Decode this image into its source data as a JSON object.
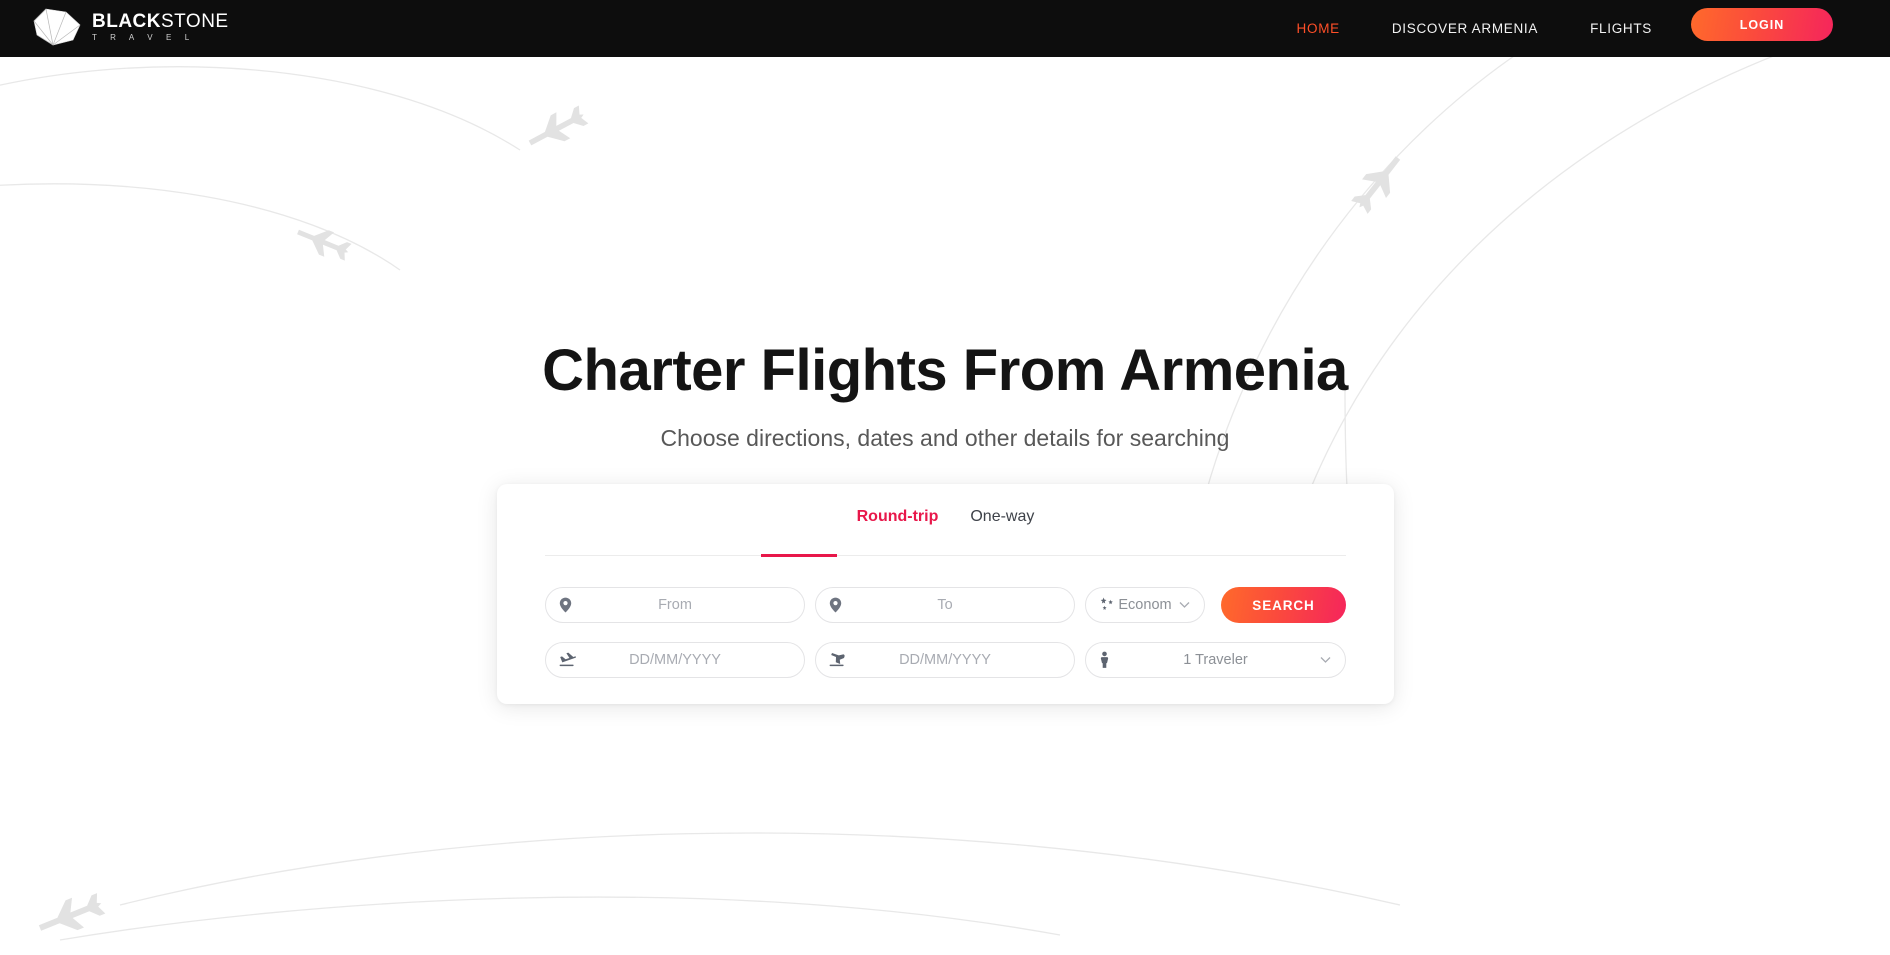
{
  "header": {
    "logo": {
      "word_bold": "BLACK",
      "word_light": "STONE",
      "subtitle": "T R A V E L",
      "mark_icon": "gem-stone-icon"
    },
    "nav": [
      {
        "label": "HOME",
        "active": true
      },
      {
        "label": "DISCOVER ARMENIA",
        "active": false
      },
      {
        "label": "FLIGHTS",
        "active": false
      }
    ],
    "login_label": "LOGIN",
    "background_color": "#0d0d0d",
    "accent_color": "#ff4f28"
  },
  "hero": {
    "title": "Charter Flights From Armenia",
    "subtitle": "Choose directions, dates and other details for searching"
  },
  "search": {
    "tabs": [
      {
        "label": "Round-trip",
        "active": true
      },
      {
        "label": "One-way",
        "active": false
      }
    ],
    "active_tab_color": "#e8174a",
    "fields": {
      "from": {
        "placeholder": "From",
        "value": "",
        "icon": "map-pin-icon"
      },
      "to": {
        "placeholder": "To",
        "value": "",
        "icon": "map-pin-icon"
      },
      "travel_class": {
        "value": "Econom",
        "icon": "stars-icon",
        "chevron": "chevron-down-icon"
      },
      "depart_date": {
        "placeholder": "DD/MM/YYYY",
        "value": "",
        "icon": "plane-takeoff-icon"
      },
      "return_date": {
        "placeholder": "DD/MM/YYYY",
        "value": "",
        "icon": "plane-landing-icon"
      },
      "travelers": {
        "value": "1 Traveler",
        "icon": "person-icon",
        "chevron": "chevron-down-icon"
      }
    },
    "search_label": "SEARCH",
    "button_gradient": [
      "#ff6a2b",
      "#f5255c"
    ]
  },
  "background": {
    "decor_icon": "airplane-trail-decoration",
    "decor_color": "#e6e6e6"
  }
}
